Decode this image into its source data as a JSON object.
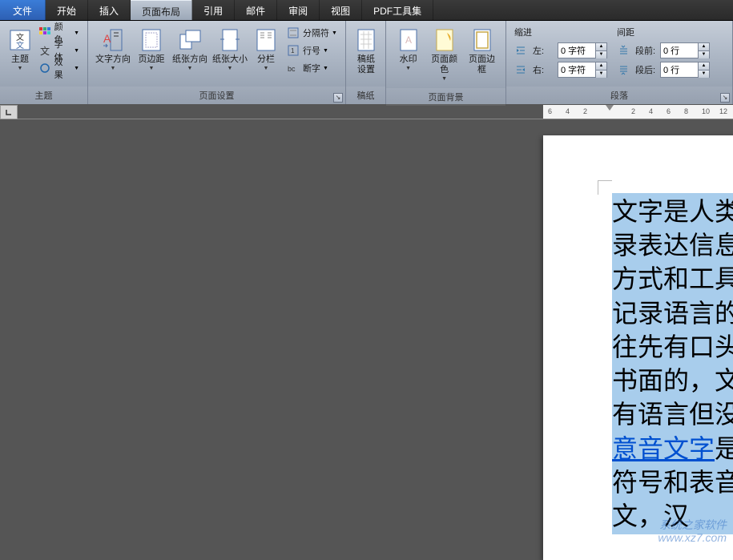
{
  "tabs": {
    "file": "文件",
    "home": "开始",
    "insert": "插入",
    "layout": "页面布局",
    "references": "引用",
    "mail": "邮件",
    "review": "审阅",
    "view": "视图",
    "pdf": "PDF工具集"
  },
  "theme": {
    "group_label": "主题",
    "themes": "主题",
    "colors": "颜色",
    "fonts": "字体",
    "effects": "效果"
  },
  "page_setup": {
    "group_label": "页面设置",
    "text_direction": "文字方向",
    "margins": "页边距",
    "orientation": "纸张方向",
    "size": "纸张大小",
    "columns": "分栏",
    "breaks": "分隔符",
    "line_numbers": "行号",
    "hyphenation": "断字"
  },
  "manuscript": {
    "group_label": "稿纸",
    "settings": "稿纸\n设置"
  },
  "background": {
    "group_label": "页面背景",
    "watermark": "水印",
    "page_color": "页面颜色",
    "page_border": "页面边框"
  },
  "paragraph": {
    "group_label": "段落",
    "indent_header": "缩进",
    "spacing_header": "间距",
    "left_label": "左:",
    "right_label": "右:",
    "before_label": "段前:",
    "after_label": "段后:",
    "left_value": "0 字符",
    "right_value": "0 字符",
    "before_value": "0 行",
    "after_value": "0 行"
  },
  "ruler": {
    "ticks": [
      "6",
      "4",
      "2",
      "",
      "2",
      "4",
      "6",
      "8",
      "10",
      "12"
    ]
  },
  "document": {
    "lines": [
      {
        "t": "文字是人类",
        "link": false
      },
      {
        "t": "录表达信息",
        "link": false
      },
      {
        "t": "方式和工具",
        "link": false
      },
      {
        "t": "记录语言的",
        "link": false
      },
      {
        "t": "往先有口头",
        "link": false
      },
      {
        "t": "书面的，文",
        "link": false
      },
      {
        "t": "有语言但没",
        "link": false
      },
      {
        "t": "意音文字是",
        "link": true,
        "link_text": "意音文字"
      },
      {
        "t": "符号和表音",
        "link": false
      },
      {
        "t": "文，汉",
        "link": false
      }
    ]
  },
  "watermark_text": {
    "l1": "系统之家软件",
    "l2": "www.xz7.com"
  }
}
